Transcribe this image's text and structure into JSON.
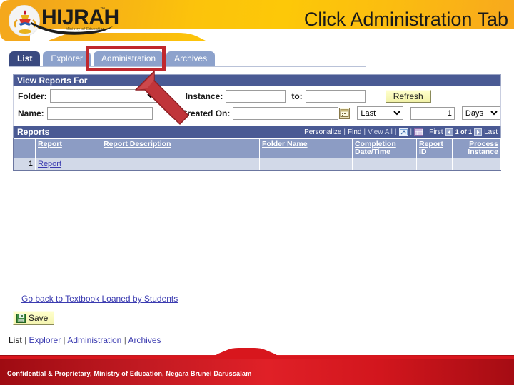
{
  "banner": {
    "logo_text": "HIJRAH",
    "logo_tm": "™",
    "logo_tagline": "Ministry of Education",
    "title": "Click Administration Tab"
  },
  "tabs": [
    {
      "label": "List",
      "active": true
    },
    {
      "label": "Explorer",
      "active": false
    },
    {
      "label": "Administration",
      "active": false
    },
    {
      "label": "Archives",
      "active": false
    }
  ],
  "filter": {
    "section_title": "View Reports For",
    "folder_label": "Folder:",
    "folder_value": "",
    "instance_label": "Instance:",
    "instance_value": "",
    "to_label": "to:",
    "to_value": "",
    "refresh_label": "Refresh",
    "name_label": "Name:",
    "name_value": "",
    "created_on_label": "Created On:",
    "created_on_value": "",
    "calendar_icon": "calendar-icon",
    "last_select_value": "Last",
    "quantity_value": "1",
    "unit_select_value": "Days"
  },
  "reports": {
    "section_title": "Reports",
    "tools": {
      "personalize": "Personalize",
      "find": "Find",
      "view_all": "View All",
      "export_icon": "export-to-excel-icon",
      "grid_icon": "grid-view-icon",
      "sep": "|"
    },
    "pager": {
      "first": "First",
      "prev_icon": "previous-page-icon",
      "count": "1 of 1",
      "next_icon": "next-page-icon",
      "last": "Last"
    },
    "columns": [
      {
        "label": "",
        "key": "num"
      },
      {
        "label": "Report",
        "key": "report"
      },
      {
        "label": "Report Description",
        "key": "desc"
      },
      {
        "label": "Folder Name",
        "key": "folder"
      },
      {
        "label": "Completion Date/Time",
        "key": "completion"
      },
      {
        "label": "Report ID",
        "key": "reportid"
      },
      {
        "label": "Process Instance",
        "key": "instance"
      }
    ],
    "rows": [
      {
        "num": "1",
        "report": "Report",
        "desc": "",
        "folder": "",
        "completion": "",
        "reportid": "",
        "instance": ""
      }
    ]
  },
  "actions": {
    "go_back_label": "Go back to Textbook Loaned by Students",
    "save_label": "Save",
    "save_icon": "floppy-disk-icon"
  },
  "footer_nav": {
    "items": [
      "List",
      "Explorer",
      "Administration",
      "Archives"
    ],
    "separator": "|"
  },
  "footer": {
    "confidential_text": "Confidential & Proprietary, Ministry of Education, Negara Brunei Darussalam"
  },
  "annotations": {
    "highlight_target": "administration-tab",
    "arrow": "red-arrow-pointing-to-administration-tab"
  },
  "colors": {
    "banner_start": "#f0a11c",
    "banner_end": "#fdc808",
    "tab_active": "#3a4a80",
    "tab_inactive": "#8da2cc",
    "section_header": "#4a5a94",
    "grid_header": "#8c9cc4",
    "grid_row": "#d2d9e8",
    "link": "#3a3ab0",
    "annotation_red": "#c0282d",
    "footer_red": "#e02027",
    "button_yellow": "#ffffcc"
  }
}
